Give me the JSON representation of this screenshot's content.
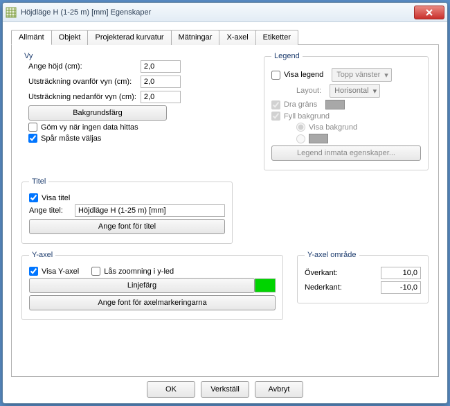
{
  "window": {
    "title": "Höjdläge H (1-25 m) [mm] Egenskaper"
  },
  "tabs": [
    "Allmänt",
    "Objekt",
    "Projekterad kurvatur",
    "Mätningar",
    "X-axel",
    "Etiketter"
  ],
  "vy": {
    "legend_title": "Vy",
    "height_label": "Ange höjd (cm):",
    "height_value": "2,0",
    "above_label": "Utsträckning ovanför vyn (cm):",
    "above_value": "2,0",
    "below_label": "Utsträckning nedanför vyn (cm):",
    "below_value": "2,0",
    "bgcolor_btn": "Bakgrundsfärg",
    "hide_label": "Göm vy när ingen data hittas",
    "track_label": "Spår måste väljas"
  },
  "legend": {
    "group_title": "Legend",
    "show_label": "Visa legend",
    "position": "Topp vänster",
    "layout_label": "Layout:",
    "layout_value": "Horisontal",
    "border_label": "Dra gräns",
    "fill_label": "Fyll bakgrund",
    "show_bg_label": "Visa bakgrund",
    "props_btn": "Legend inmata egenskaper..."
  },
  "titel": {
    "group_title": "Titel",
    "show_label": "Visa titel",
    "title_label": "Ange titel:",
    "title_value": "Höjdläge H (1-25 m) [mm]",
    "font_btn": "Ange font för titel"
  },
  "yaxis": {
    "group_title": "Y-axel",
    "show_label": "Visa Y-axel",
    "lock_label": "Lås zoomning i y-led",
    "linecolor_btn": "Linjefärg",
    "font_btn": "Ange font för axelmarkeringarna",
    "range_group": "Y-axel område",
    "top_label": "Överkant:",
    "top_value": "10,0",
    "bottom_label": "Nederkant:",
    "bottom_value": "-10,0"
  },
  "footer": {
    "ok": "OK",
    "apply": "Verkställ",
    "cancel": "Avbryt"
  }
}
